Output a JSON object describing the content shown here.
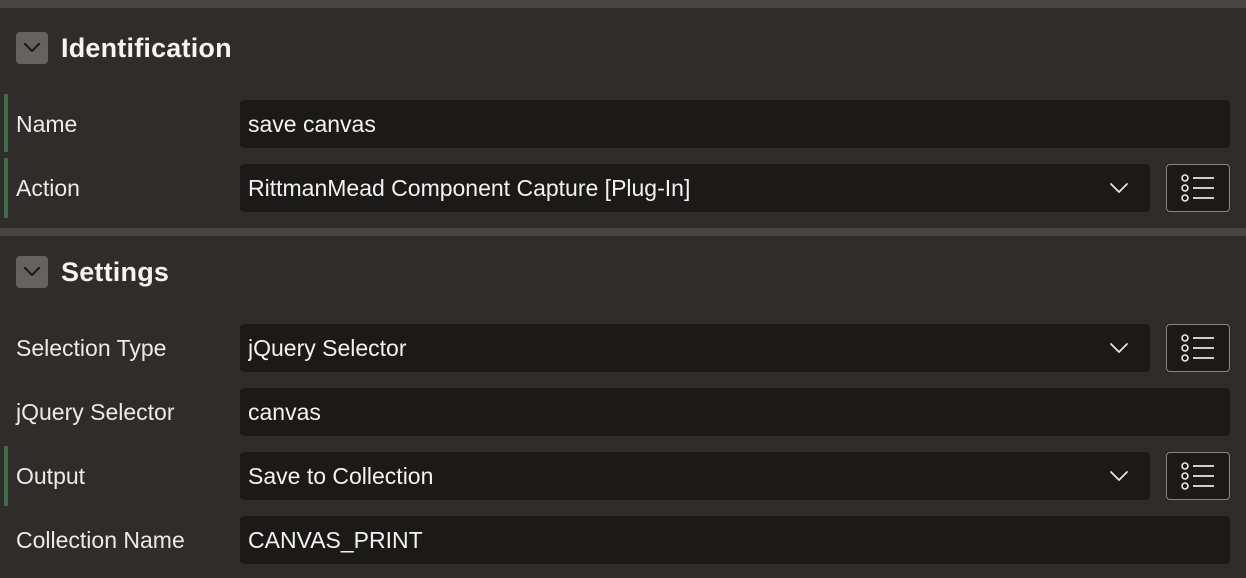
{
  "sections": {
    "identification": {
      "title": "Identification",
      "chevron_icon": "chevron-down-icon",
      "fields": {
        "name": {
          "label": "Name",
          "value": "save canvas"
        },
        "action": {
          "label": "Action",
          "value": "RittmanMead Component Capture [Plug-In]",
          "list_icon": "list-icon"
        }
      }
    },
    "settings": {
      "title": "Settings",
      "chevron_icon": "chevron-down-icon",
      "fields": {
        "selection_type": {
          "label": "Selection Type",
          "value": "jQuery Selector",
          "list_icon": "list-icon"
        },
        "jquery_selector": {
          "label": "jQuery Selector",
          "value": "canvas"
        },
        "output": {
          "label": "Output",
          "value": "Save to Collection",
          "list_icon": "list-icon"
        },
        "collection_name": {
          "label": "Collection Name",
          "value": "CANVAS_PRINT"
        }
      }
    }
  },
  "colors": {
    "background": "#2f2c29",
    "field_background": "#1b1a19",
    "separator": "#48443f",
    "required_marker": "#3e6f4b",
    "chevron_box": "#66625d"
  }
}
